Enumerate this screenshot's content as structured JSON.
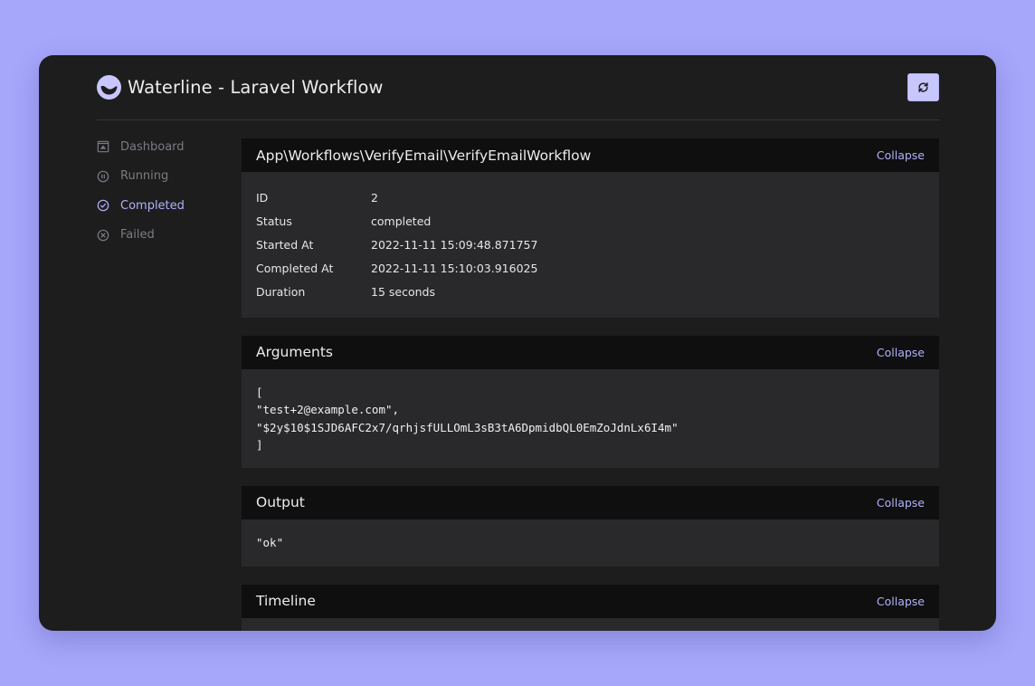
{
  "app": {
    "title": "Waterline - Laravel Workflow",
    "accent": "#b1b1fa",
    "background": "#a6a6fb",
    "window_bg": "#1d1d1e"
  },
  "toolbar": {
    "refresh_icon": "refresh-icon"
  },
  "sidebar": {
    "items": [
      {
        "label": "Dashboard",
        "icon": "dashboard-icon",
        "active": false
      },
      {
        "label": "Running",
        "icon": "pause-circle-icon",
        "active": false
      },
      {
        "label": "Completed",
        "icon": "check-circle-icon",
        "active": true
      },
      {
        "label": "Failed",
        "icon": "x-circle-icon",
        "active": false
      }
    ]
  },
  "workflow": {
    "title": "App\\Workflows\\VerifyEmail\\VerifyEmailWorkflow",
    "collapse_label": "Collapse",
    "details": [
      {
        "label": "ID",
        "value": "2"
      },
      {
        "label": "Status",
        "value": "completed"
      },
      {
        "label": "Started At",
        "value": "2022-11-11 15:09:48.871757"
      },
      {
        "label": "Completed At",
        "value": "2022-11-11 15:10:03.916025"
      },
      {
        "label": "Duration",
        "value": "15 seconds"
      }
    ]
  },
  "arguments": {
    "title": "Arguments",
    "collapse_label": "Collapse",
    "lines": [
      "[",
      "\"test+2@example.com\",",
      "\"$2y$10$1SJD6AFC2x7/qrhjsfULLOmL3sB3tA6DpmidbQL0EmZoJdnLx6I4m\"",
      "]"
    ]
  },
  "output": {
    "title": "Output",
    "collapse_label": "Collapse",
    "value": "\"ok\""
  },
  "timeline": {
    "title": "Timeline",
    "collapse_label": "Collapse"
  }
}
